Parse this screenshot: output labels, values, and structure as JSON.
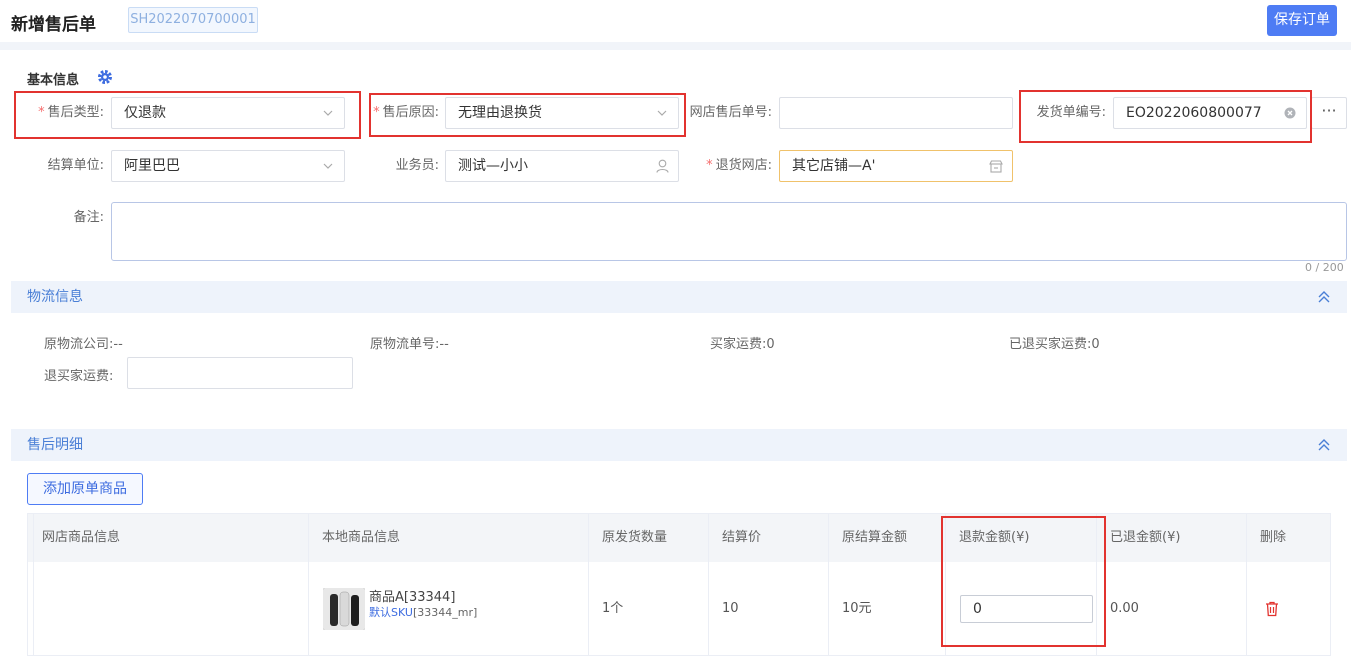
{
  "header": {
    "title": "新增售后单",
    "order_no": "SH2022070700001",
    "save_label": "保存订单"
  },
  "basic": {
    "section_title": "基本信息",
    "aftersale_type": {
      "label": "售后类型:",
      "value": "仅退款"
    },
    "aftersale_reason": {
      "label": "售后原因:",
      "value": "无理由退换货"
    },
    "shop_aftersale_no": {
      "label": "网店售后单号:",
      "value": ""
    },
    "delivery_no": {
      "label": "发货单编号:",
      "value": "EO2022060800077"
    },
    "more_label": "···",
    "settle_unit": {
      "label": "结算单位:",
      "value": "阿里巴巴"
    },
    "salesman": {
      "label": "业务员:",
      "value": "测试—小小"
    },
    "return_shop": {
      "label": "退货网店:",
      "value": "其它店铺—A'"
    },
    "remark": {
      "label": "备注:",
      "value": "",
      "counter": "0 / 200"
    }
  },
  "logistics": {
    "section_title": "物流信息",
    "orig_company_label": "原物流公司:",
    "orig_company_value": "--",
    "orig_tracking_label": "原物流单号:",
    "orig_tracking_value": "--",
    "buyer_freight_label": "买家运费:",
    "buyer_freight_value": "0",
    "refunded_freight_label": "已退买家运费:",
    "refunded_freight_value": "0",
    "refund_freight_label": "退买家运费:",
    "refund_freight_value": ""
  },
  "details": {
    "section_title": "售后明细",
    "add_button": "添加原单商品",
    "columns": [
      "网店商品信息",
      "本地商品信息",
      "原发货数量",
      "结算价",
      "原结算金额",
      "退款金额(¥)",
      "已退金额(¥)",
      "删除"
    ],
    "rows": [
      {
        "shop_item": "",
        "local_name": "商品A[33344]",
        "local_sku_prefix": "默认SKU",
        "local_sku_code": "[33344_mr]",
        "orig_qty": "1个",
        "settle_price": "10",
        "orig_amount": "10元",
        "refund_amount": "0",
        "refunded_amount": "0.00"
      }
    ]
  },
  "colors": {
    "accent": "#4e7cf4",
    "highlight_box": "#e2332f",
    "required": "#f56c6c",
    "section_band": "#eef3fb"
  }
}
